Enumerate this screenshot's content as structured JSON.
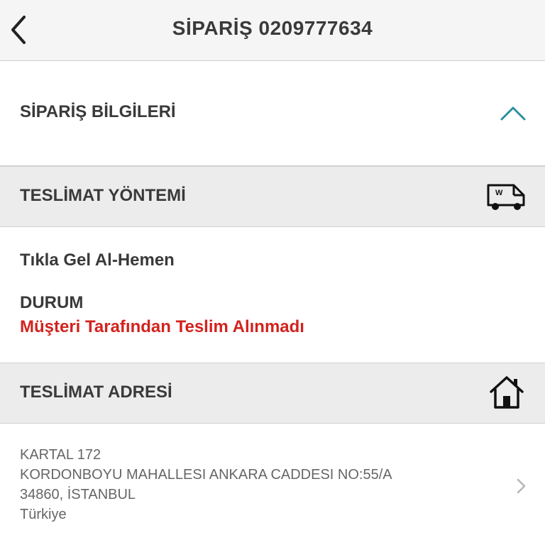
{
  "header": {
    "title": "SİPARİŞ 0209777634",
    "back_icon": "chevron-left-icon"
  },
  "order_info": {
    "label": "SİPARİŞ BİLGİLERİ",
    "toggle_icon": "chevron-up-icon",
    "accent": "#2a8fa0"
  },
  "delivery_method": {
    "label": "TESLİMAT YÖNTEMİ",
    "icon": "delivery-van-icon",
    "value": "Tıkla Gel Al-Hemen",
    "status_label": "DURUM",
    "status_value": "Müşteri Tarafından Teslim Alınmadı",
    "status_color": "#d2231e"
  },
  "delivery_address": {
    "label": "TESLİMAT ADRESİ",
    "icon": "home-icon",
    "lines": [
      "KARTAL 172",
      "KORDONBOYU MAHALLESI ANKARA CADDESI NO:55/A",
      "34860, İSTANBUL",
      "Türkiye"
    ],
    "chevron_icon": "chevron-right-icon"
  }
}
